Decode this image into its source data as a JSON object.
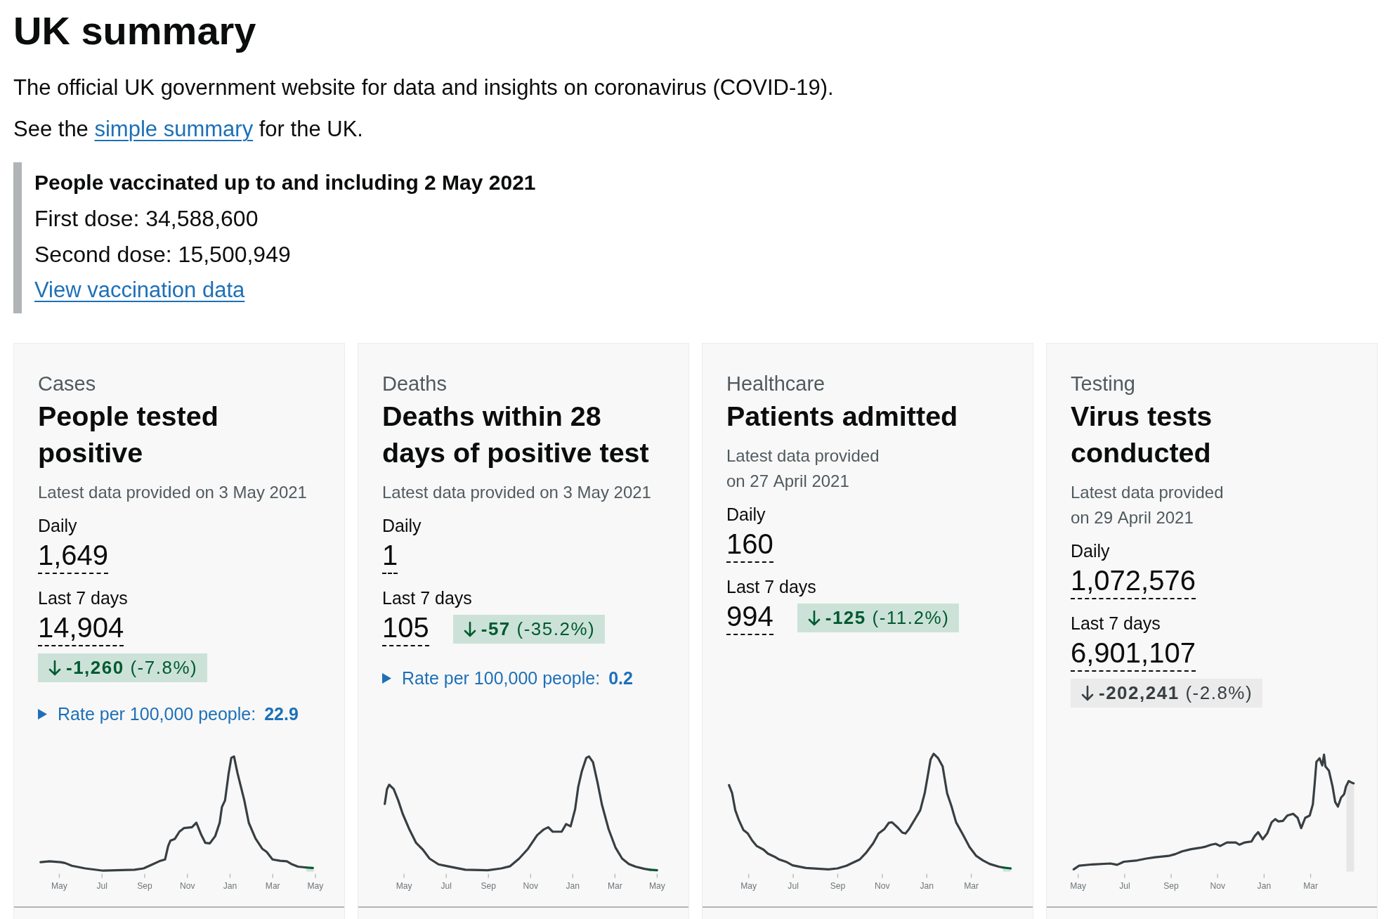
{
  "page_title": "UK summary",
  "intro": "The official UK government website for data and insights on coronavirus (COVID-19).",
  "summary_note": {
    "before": "See the ",
    "link": "simple summary",
    "after": " for the UK."
  },
  "vaccination": {
    "heading": "People vaccinated up to and including 2 May 2021",
    "lines": [
      "First dose: 34,588,600",
      "Second dose: 15,500,949"
    ],
    "link": "View vaccination data"
  },
  "cards": [
    {
      "category": "Cases",
      "title": "People tested positive",
      "updated": "Latest data provided on 3 May 2021",
      "metrics": [
        {
          "label": "Daily",
          "value": "1,649"
        },
        {
          "label": "Last 7 days",
          "value": "14,904",
          "change": {
            "text": "**-1,260** (-7.8%)",
            "decrease": true,
            "kind": "good"
          }
        }
      ],
      "rate": {
        "label": "Rate per 100,000 people:",
        "value": "22.9"
      },
      "chart_axis": [
        "May",
        "Jul",
        "Sep",
        "Nov",
        "Jan",
        "Mar",
        "May"
      ]
    },
    {
      "category": "Deaths",
      "title": "Deaths within 28 days of positive test",
      "updated": "Latest data provided on 3 May 2021",
      "metrics": [
        {
          "label": "Daily",
          "value": "1"
        },
        {
          "label": "Last 7 days",
          "value": "105",
          "change": {
            "text": "**-57** (-35.2%)",
            "decrease": true,
            "kind": "good"
          }
        }
      ],
      "rate": {
        "label": "Rate per 100,000 people:",
        "value": "0.2"
      },
      "chart_axis": [
        "May",
        "Jul",
        "Sep",
        "Nov",
        "Jan",
        "Mar",
        "May"
      ]
    },
    {
      "category": "Healthcare",
      "title": "Patients admitted",
      "updated": "Latest data provided on 27 April 2021",
      "metrics": [
        {
          "label": "Daily",
          "value": "160"
        },
        {
          "label": "Last 7 days",
          "value": "994",
          "change": {
            "text": "**-125** (-11.2%)",
            "decrease": true,
            "kind": "good"
          }
        }
      ],
      "chart_axis": [
        "May",
        "Jul",
        "Sep",
        "Nov",
        "Jan",
        "Mar"
      ]
    },
    {
      "category": "Testing",
      "title": "Virus tests conducted",
      "updated": "Latest data provided on 29 April 2021",
      "metrics": [
        {
          "label": "Daily",
          "value": "1,072,576"
        },
        {
          "label": "Last 7 days",
          "value": "6,901,107",
          "change": {
            "text": "**-202,241** (-2.8%)",
            "decrease": true,
            "kind": "neutral"
          }
        }
      ],
      "chart_axis": [
        "May",
        "Jul",
        "Sep",
        "Nov",
        "Jan",
        "Mar"
      ]
    }
  ]
}
